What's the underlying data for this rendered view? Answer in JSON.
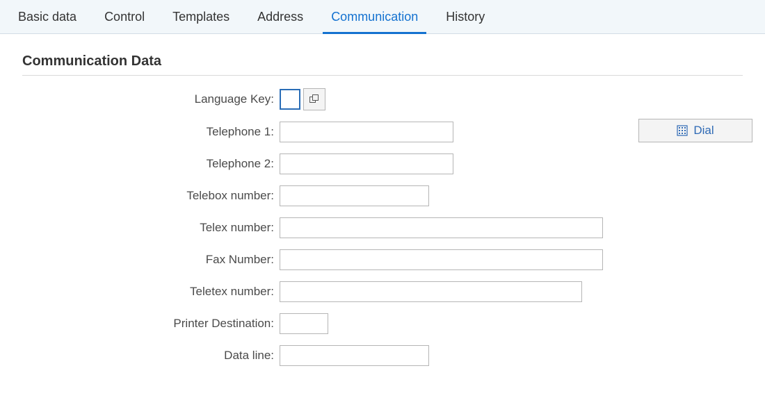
{
  "tabs": [
    {
      "label": "Basic data",
      "active": false
    },
    {
      "label": "Control",
      "active": false
    },
    {
      "label": "Templates",
      "active": false
    },
    {
      "label": "Address",
      "active": false
    },
    {
      "label": "Communication",
      "active": true
    },
    {
      "label": "History",
      "active": false
    }
  ],
  "section": {
    "title": "Communication Data"
  },
  "fields": {
    "language_key": {
      "label": "Language Key:",
      "value": ""
    },
    "telephone1": {
      "label": "Telephone 1:",
      "value": ""
    },
    "telephone2": {
      "label": "Telephone 2:",
      "value": ""
    },
    "telebox_number": {
      "label": "Telebox number:",
      "value": ""
    },
    "telex_number": {
      "label": "Telex number:",
      "value": ""
    },
    "fax_number": {
      "label": "Fax Number:",
      "value": ""
    },
    "teletex_number": {
      "label": "Teletex number:",
      "value": ""
    },
    "printer_destination": {
      "label": "Printer Destination:",
      "value": ""
    },
    "data_line": {
      "label": "Data line:",
      "value": ""
    }
  },
  "buttons": {
    "dial": "Dial"
  }
}
